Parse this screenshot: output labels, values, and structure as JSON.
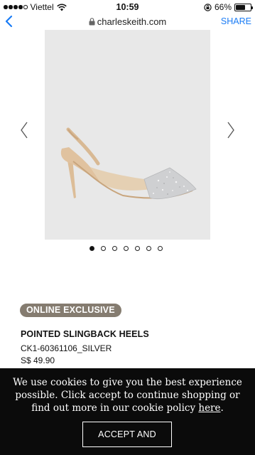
{
  "status_bar": {
    "carrier": "Viettel",
    "time": "10:59",
    "battery_percent": "66%",
    "battery_level": 0.66,
    "signal_bars_filled": 4,
    "signal_bars_total": 5
  },
  "browser": {
    "url": "charleskeith.com",
    "share_label": "SHARE"
  },
  "gallery": {
    "image_count": 7,
    "active_index": 0
  },
  "product": {
    "badge": "ONLINE EXCLUSIVE",
    "title": "POINTED SLINGBACK HEELS",
    "sku": "CK1-60361106_SILVER",
    "price": "S$ 49.90"
  },
  "cookie_banner": {
    "text_before_link": "We use cookies to give you the best experience possible. Click accept to continue shopping or find out more in our cookie policy ",
    "link_text": "here",
    "text_after_link": ".",
    "accept_label": "ACCEPT AND CLOSE"
  },
  "colors": {
    "accent": "#1a7cf5",
    "badge": "#857c70",
    "banner_bg": "#0b0b0b",
    "image_bg": "#e8e8e8"
  }
}
